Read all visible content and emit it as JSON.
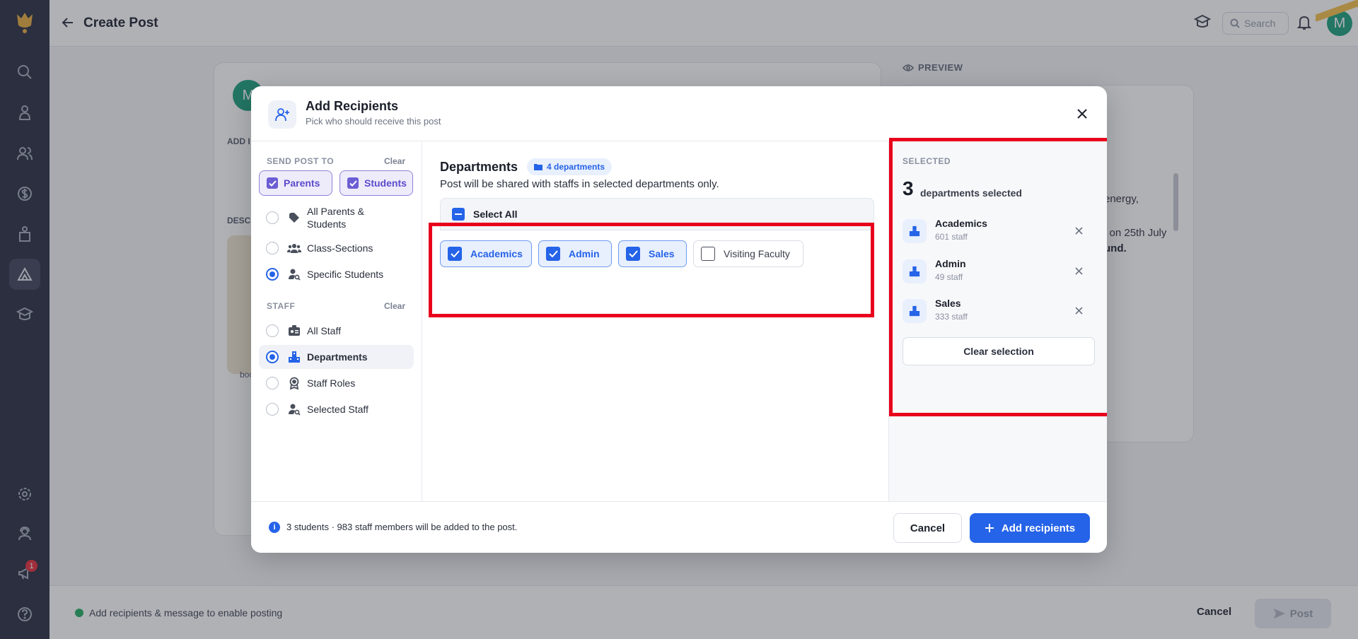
{
  "app": {
    "page_title": "Create Post",
    "search_placeholder": "Search",
    "avatar_initial": "M",
    "notification_count": "1"
  },
  "background": {
    "add_label": "ADD I",
    "desc_label": "DESC",
    "body_snippet": "boo",
    "preview_label": "PREVIEW",
    "preview_line1": "energy,",
    "preview_line2": "l on 25th July",
    "preview_line3": "und.",
    "bottom_status": "Add recipients & message to enable posting",
    "bottom_cancel": "Cancel",
    "bottom_post": "Post"
  },
  "modal": {
    "title": "Add Recipients",
    "subtitle": "Pick who should receive this post",
    "send_post_to": {
      "heading": "SEND POST TO",
      "clear": "Clear",
      "toggles": [
        {
          "label": "Parents",
          "checked": true
        },
        {
          "label": "Students",
          "checked": true
        }
      ],
      "options": [
        {
          "label": "All Parents & Students",
          "selected": false,
          "icon": "tag-icon"
        },
        {
          "label": "Class-Sections",
          "selected": false,
          "icon": "users-group-icon"
        },
        {
          "label": "Specific Students",
          "selected": true,
          "icon": "user-search-icon"
        }
      ]
    },
    "staff": {
      "heading": "STAFF",
      "clear": "Clear",
      "options": [
        {
          "label": "All Staff",
          "selected": false,
          "icon": "id-badge-icon"
        },
        {
          "label": "Departments",
          "selected": true,
          "icon": "building-icon"
        },
        {
          "label": "Staff Roles",
          "selected": false,
          "icon": "award-icon"
        },
        {
          "label": "Selected Staff",
          "selected": false,
          "icon": "user-search-icon"
        }
      ]
    },
    "departments": {
      "title": "Departments",
      "badge": "4 departments",
      "subtitle": "Post will be shared with staffs in selected departments only.",
      "select_all": "Select All",
      "items": [
        {
          "label": "Academics",
          "checked": true
        },
        {
          "label": "Admin",
          "checked": true
        },
        {
          "label": "Sales",
          "checked": true
        },
        {
          "label": "Visiting Faculty",
          "checked": false
        }
      ]
    },
    "selected": {
      "heading": "SELECTED",
      "count": "3",
      "count_label": "departments selected",
      "items": [
        {
          "name": "Academics",
          "count": "601 staff"
        },
        {
          "name": "Admin",
          "count": "49 staff"
        },
        {
          "name": "Sales",
          "count": "333 staff"
        }
      ],
      "clear_selection": "Clear selection"
    },
    "footer": {
      "summary": "3 students · 983 staff members will be added to the post.",
      "cancel": "Cancel",
      "add": "Add recipients"
    }
  },
  "colors": {
    "primary": "#2563e8",
    "purple": "#6b5dd3",
    "highlight_red": "#e8001c",
    "rail": "#363b4c"
  }
}
